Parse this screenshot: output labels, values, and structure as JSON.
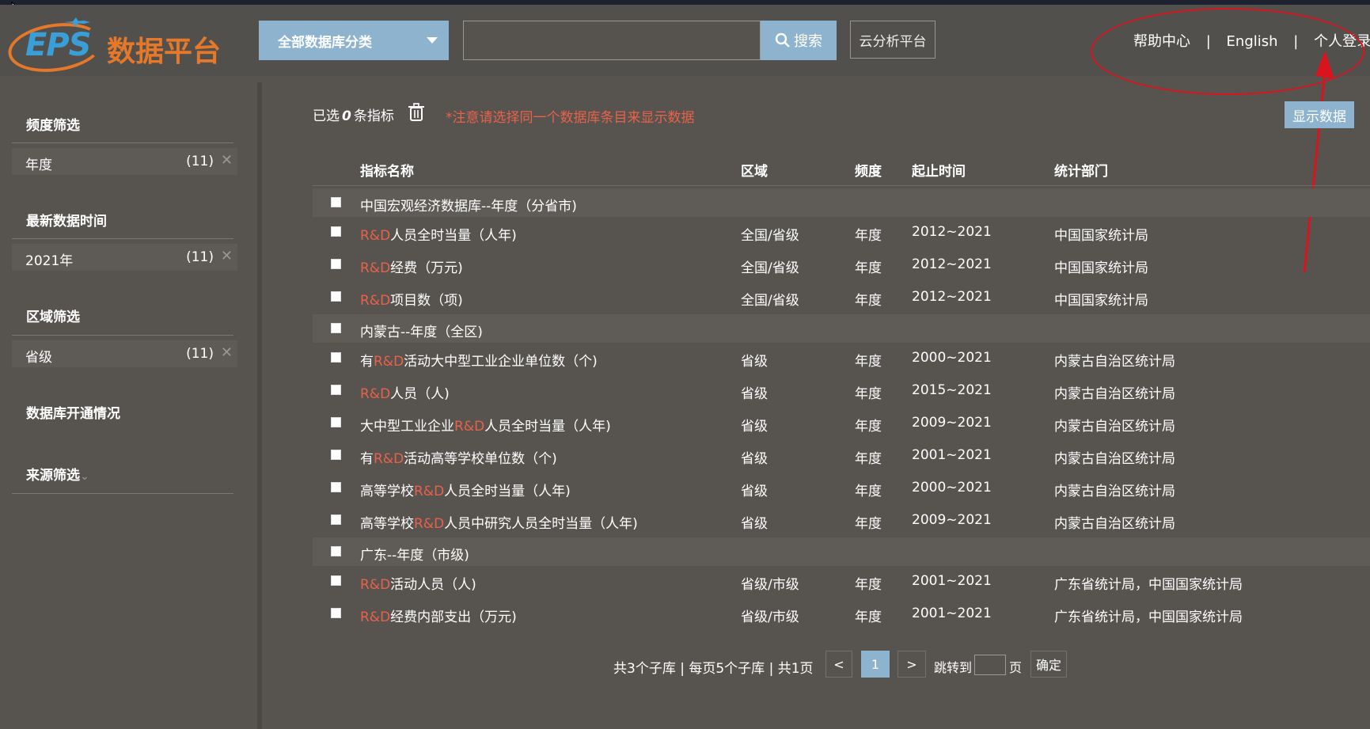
{
  "header": {
    "logo_text": "EPS",
    "logo_cn": "数据平台",
    "category_select": "全部数据库分类",
    "search_value": "",
    "search_button": "搜索",
    "cloud_button": "云分析平台",
    "links": {
      "help": "帮助中心",
      "english": "English",
      "login": "个人登录",
      "sep": "|"
    }
  },
  "sidebar": {
    "frequency": {
      "title": "频度筛选",
      "chip": {
        "label": "年度",
        "count": "(11)"
      }
    },
    "latest": {
      "title": "最新数据时间",
      "chip": {
        "label": "2021年",
        "count": "(11)"
      }
    },
    "region": {
      "title": "区域筛选",
      "chip": {
        "label": "省级",
        "count": "(11)"
      }
    },
    "db_status": {
      "title": "数据库开通情况"
    },
    "source": {
      "title": "来源筛选",
      "caret": "⌄"
    },
    "remove_glyph": "✕"
  },
  "main": {
    "selected_prefix": "已选",
    "selected_count": "0",
    "selected_suffix": "条指标",
    "notice": "*注意请选择同一个数据库条目来显示数据",
    "show_button": "显示数据",
    "columns": {
      "name": "指标名称",
      "region": "区域",
      "freq": "频度",
      "period": "起止时间",
      "dept": "统计部门"
    },
    "groups": [
      {
        "title": "中国宏观经济数据库--年度（分省市)"
      },
      {
        "title": "内蒙古--年度（全区)"
      },
      {
        "title": "广东--年度（市级)"
      }
    ],
    "rows": [
      {
        "pre": "",
        "hl": "R&D",
        "post": "人员全时当量（人年)",
        "region": "全国/省级",
        "freq": "年度",
        "period": "2012~2021",
        "dept": "中国国家统计局"
      },
      {
        "pre": "",
        "hl": "R&D",
        "post": "经费（万元)",
        "region": "全国/省级",
        "freq": "年度",
        "period": "2012~2021",
        "dept": "中国国家统计局"
      },
      {
        "pre": "",
        "hl": "R&D",
        "post": "项目数（项)",
        "region": "全国/省级",
        "freq": "年度",
        "period": "2012~2021",
        "dept": "中国国家统计局"
      },
      {
        "pre": "有",
        "hl": "R&D",
        "post": "活动大中型工业企业单位数（个)",
        "region": "省级",
        "freq": "年度",
        "period": "2000~2021",
        "dept": "内蒙古自治区统计局"
      },
      {
        "pre": "",
        "hl": "R&D",
        "post": "人员（人)",
        "region": "省级",
        "freq": "年度",
        "period": "2015~2021",
        "dept": "内蒙古自治区统计局"
      },
      {
        "pre": "大中型工业企业",
        "hl": "R&D",
        "post": "人员全时当量（人年)",
        "region": "省级",
        "freq": "年度",
        "period": "2009~2021",
        "dept": "内蒙古自治区统计局"
      },
      {
        "pre": "有",
        "hl": "R&D",
        "post": "活动高等学校单位数（个)",
        "region": "省级",
        "freq": "年度",
        "period": "2001~2021",
        "dept": "内蒙古自治区统计局"
      },
      {
        "pre": "高等学校",
        "hl": "R&D",
        "post": "人员全时当量（人年)",
        "region": "省级",
        "freq": "年度",
        "period": "2000~2021",
        "dept": "内蒙古自治区统计局"
      },
      {
        "pre": "高等学校",
        "hl": "R&D",
        "post": "人员中研究人员全时当量（人年)",
        "region": "省级",
        "freq": "年度",
        "period": "2009~2021",
        "dept": "内蒙古自治区统计局"
      },
      {
        "pre": "",
        "hl": "R&D",
        "post": "活动人员（人)",
        "region": "省级/市级",
        "freq": "年度",
        "period": "2001~2021",
        "dept": "广东省统计局，中国国家统计局"
      },
      {
        "pre": "",
        "hl": "R&D",
        "post": "经费内部支出（万元)",
        "region": "省级/市级",
        "freq": "年度",
        "period": "2001~2021",
        "dept": "广东省统计局，中国国家统计局"
      }
    ]
  },
  "pagination": {
    "summary": "共3个子库 | 每页5个子库 | 共1页",
    "prev": "<",
    "current": "1",
    "next": ">",
    "jump_label": "跳转到",
    "page_unit": "页",
    "confirm": "确定"
  },
  "colors": {
    "accent_blue": "#8eb3cf",
    "highlight_red": "#e8614a",
    "annotation_red": "#d9141e",
    "logo_orange": "#e6782a"
  }
}
